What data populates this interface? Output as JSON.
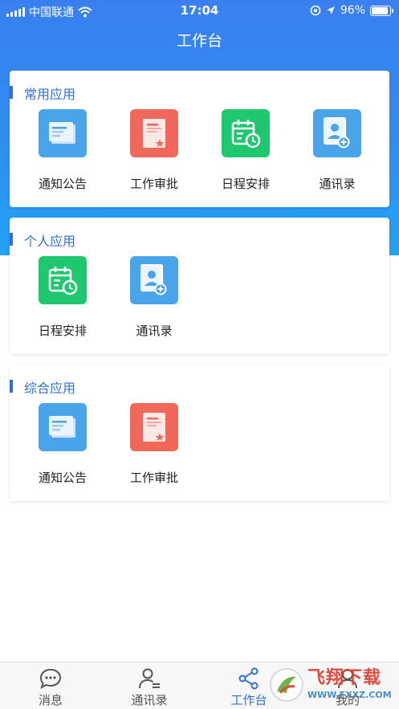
{
  "statusbar": {
    "carrier": "中国联通",
    "time": "17:04",
    "battery": "96%",
    "battery_level": 0.96
  },
  "header": {
    "title": "工作台"
  },
  "sections": [
    {
      "title": "常用应用",
      "apps": [
        {
          "label": "通知公告",
          "icon": "notice-icon",
          "color": "#4aa4ea"
        },
        {
          "label": "工作审批",
          "icon": "approval-icon",
          "color": "#f0685a"
        },
        {
          "label": "日程安排",
          "icon": "calendar-icon",
          "color": "#1fc76e"
        },
        {
          "label": "通讯录",
          "icon": "contacts-icon",
          "color": "#4aa4ea"
        }
      ]
    },
    {
      "title": "个人应用",
      "apps": [
        {
          "label": "日程安排",
          "icon": "calendar-icon",
          "color": "#1fc76e"
        },
        {
          "label": "通讯录",
          "icon": "contacts-icon",
          "color": "#4aa4ea"
        }
      ]
    },
    {
      "title": "综合应用",
      "apps": [
        {
          "label": "通知公告",
          "icon": "notice-icon",
          "color": "#4aa4ea"
        },
        {
          "label": "工作审批",
          "icon": "approval-icon",
          "color": "#f0685a"
        }
      ]
    }
  ],
  "tabs": [
    {
      "label": "消息",
      "icon": "chat-icon"
    },
    {
      "label": "通讯录",
      "icon": "contacts-tab-icon"
    },
    {
      "label": "工作台",
      "icon": "share-nodes-icon",
      "active": true
    },
    {
      "label": "我的",
      "icon": "user-icon"
    }
  ],
  "watermark": {
    "text": "飞翔下载",
    "url": "WWW.FXXZ.COM"
  },
  "colors": {
    "primary": "#2f6fd6",
    "header_gradient_top": "#3a7ff0",
    "header_gradient_bottom": "#21a2f5"
  }
}
